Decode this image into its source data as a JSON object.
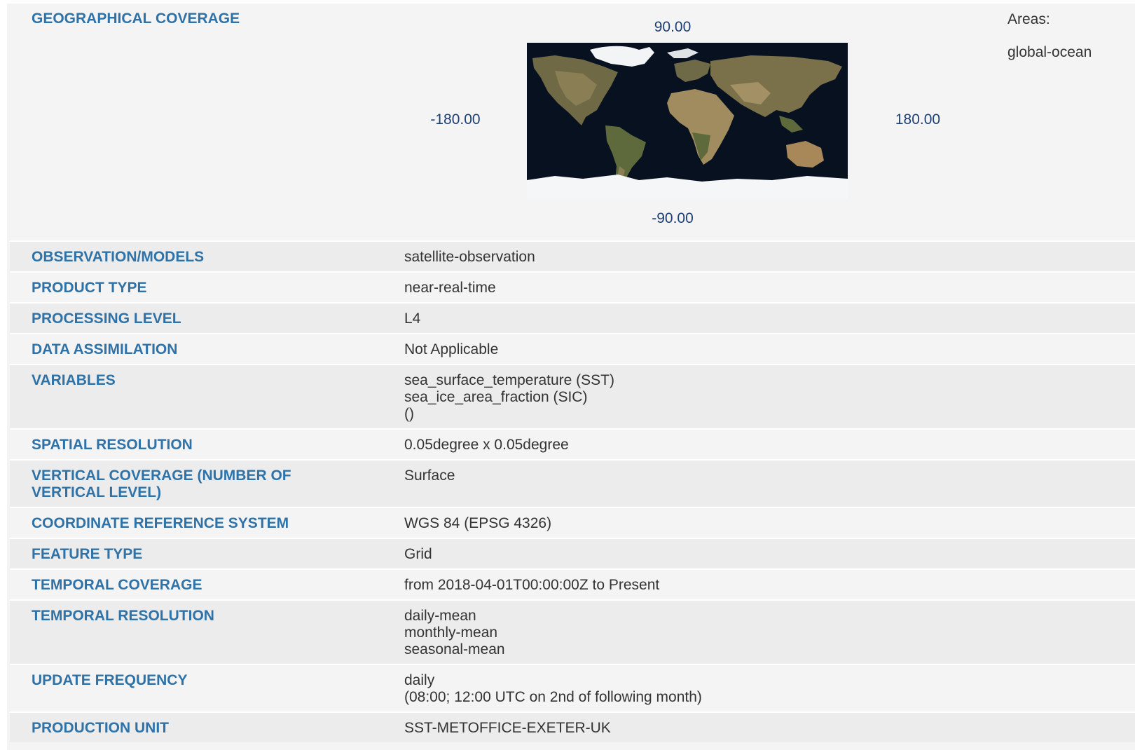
{
  "geo": {
    "label": "GEOGRAPHICAL COVERAGE",
    "north": "90.00",
    "south": "-90.00",
    "west": "-180.00",
    "east": "180.00",
    "areas_label": "Areas:",
    "areas_value": "global-ocean"
  },
  "rows": [
    {
      "label": "OBSERVATION/MODELS",
      "lines": [
        "satellite-observation"
      ]
    },
    {
      "label": "PRODUCT TYPE",
      "lines": [
        "near-real-time"
      ]
    },
    {
      "label": "PROCESSING LEVEL",
      "lines": [
        "L4"
      ]
    },
    {
      "label": "DATA ASSIMILATION",
      "lines": [
        "Not Applicable"
      ]
    },
    {
      "label": "VARIABLES",
      "lines": [
        "sea_surface_temperature (SST)",
        "sea_ice_area_fraction (SIC)",
        "()"
      ]
    },
    {
      "label": "SPATIAL RESOLUTION",
      "lines": [
        "0.05degree x 0.05degree"
      ]
    },
    {
      "label": "VERTICAL COVERAGE (NUMBER OF VERTICAL LEVEL)",
      "lines": [
        "Surface"
      ]
    },
    {
      "label": "COORDINATE REFERENCE SYSTEM",
      "lines": [
        "WGS 84 (EPSG 4326)"
      ]
    },
    {
      "label": "FEATURE TYPE",
      "lines": [
        "Grid"
      ]
    },
    {
      "label": "TEMPORAL COVERAGE",
      "lines": [
        "from 2018-04-01T00:00:00Z to Present"
      ]
    },
    {
      "label": "TEMPORAL RESOLUTION",
      "lines": [
        "daily-mean",
        "monthly-mean",
        "seasonal-mean"
      ]
    },
    {
      "label": "UPDATE FREQUENCY",
      "lines": [
        "daily",
        "(08:00; 12:00 UTC on 2nd of following month)"
      ]
    },
    {
      "label": "PRODUCTION UNIT",
      "lines": [
        "SST-METOFFICE-EXETER-UK"
      ]
    }
  ],
  "colors": {
    "label": "#2e72a8",
    "coord": "#1d3f73",
    "value": "#333333",
    "ocean": "#07111f",
    "ice": "#f4f6f8",
    "land": "#8a7a52"
  }
}
